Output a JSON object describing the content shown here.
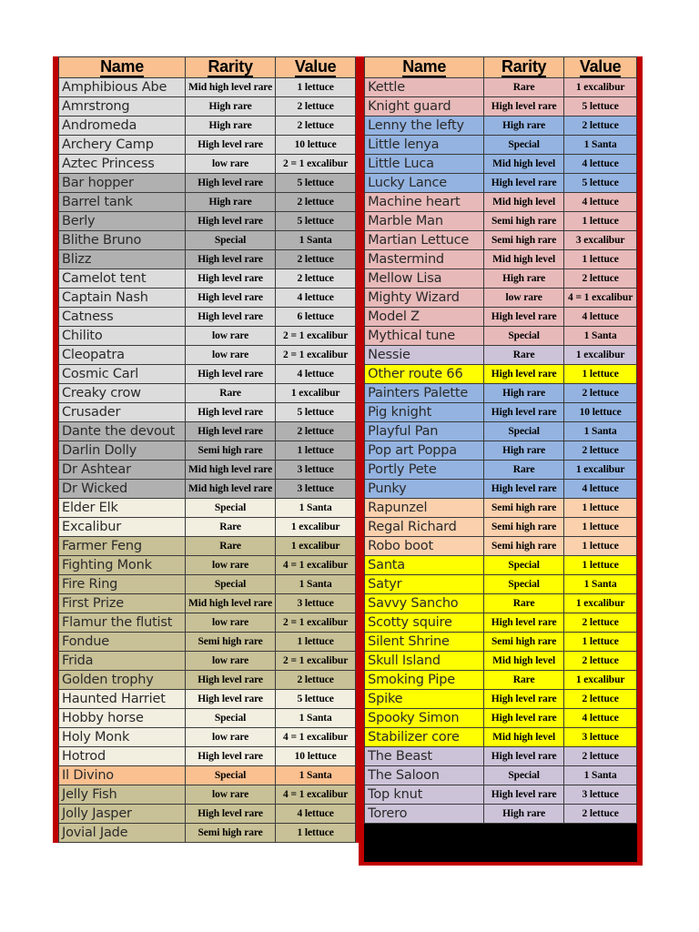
{
  "colors": {
    "frame_red": "#c00000",
    "header_bg": "#fac090",
    "group_light_gray": "#dcdcdc",
    "group_dark_gray": "#b0b0b0",
    "group_cream": "#f2efe1",
    "group_khaki": "#c8c096",
    "group_peach": "#fac090",
    "group_pink": "#e8b9b9",
    "group_blue": "#94b3e0",
    "group_lavender": "#cdc3d8",
    "group_yellow": "#ffff00",
    "group_black": "#000000"
  },
  "headers": {
    "name": "Name",
    "rarity": "Rarity",
    "value": "Value"
  },
  "left_table": {
    "rows": [
      {
        "name": "Amphibious Abe",
        "rarity": "Mid high level rare",
        "value": "1 lettuce",
        "bg": "#dcdcdc"
      },
      {
        "name": "Amrstrong",
        "rarity": "High rare",
        "value": "2 lettuce",
        "bg": "#dcdcdc"
      },
      {
        "name": "Andromeda",
        "rarity": "High rare",
        "value": "2 lettuce",
        "bg": "#dcdcdc"
      },
      {
        "name": "Archery Camp",
        "rarity": "High level rare",
        "value": "10 lettuce",
        "bg": "#dcdcdc"
      },
      {
        "name": "Aztec Princess",
        "rarity": "low rare",
        "value": "2 = 1 excalibur",
        "bg": "#dcdcdc"
      },
      {
        "name": "Bar hopper",
        "rarity": "High level rare",
        "value": "5 lettuce",
        "bg": "#b0b0b0"
      },
      {
        "name": "Barrel tank",
        "rarity": "High rare",
        "value": "2 lettuce",
        "bg": "#b0b0b0"
      },
      {
        "name": "Berly",
        "rarity": "High level rare",
        "value": "5 lettuce",
        "bg": "#b0b0b0"
      },
      {
        "name": "Blithe Bruno",
        "rarity": "Special",
        "value": "1 Santa",
        "bg": "#b0b0b0"
      },
      {
        "name": "Blizz",
        "rarity": "High level rare",
        "value": "2 lettuce",
        "bg": "#b0b0b0"
      },
      {
        "name": "Camelot tent",
        "rarity": "High level rare",
        "value": "2 lettuce",
        "bg": "#dcdcdc"
      },
      {
        "name": "Captain Nash",
        "rarity": "High level rare",
        "value": "4 lettuce",
        "bg": "#dcdcdc"
      },
      {
        "name": "Catness",
        "rarity": "High level rare",
        "value": "6 lettuce",
        "bg": "#dcdcdc"
      },
      {
        "name": "Chilito",
        "rarity": "low rare",
        "value": "2 = 1 excalibur",
        "bg": "#dcdcdc"
      },
      {
        "name": "Cleopatra",
        "rarity": "low rare",
        "value": "2 = 1 excalibur",
        "bg": "#dcdcdc"
      },
      {
        "name": "Cosmic Carl",
        "rarity": "High level rare",
        "value": "4 lettuce",
        "bg": "#dcdcdc"
      },
      {
        "name": "Creaky crow",
        "rarity": "Rare",
        "value": "1 excalibur",
        "bg": "#dcdcdc"
      },
      {
        "name": "Crusader",
        "rarity": "High level rare",
        "value": "5 lettuce",
        "bg": "#dcdcdc"
      },
      {
        "name": "Dante the devout",
        "rarity": "High level rare",
        "value": "2 lettuce",
        "bg": "#b0b0b0"
      },
      {
        "name": "Darlin Dolly",
        "rarity": "Semi high rare",
        "value": "1 lettuce",
        "bg": "#b0b0b0"
      },
      {
        "name": "Dr Ashtear",
        "rarity": "Mid high level rare",
        "value": "3 lettuce",
        "bg": "#b0b0b0"
      },
      {
        "name": "Dr Wicked",
        "rarity": "Mid high level rare",
        "value": "3 lettuce",
        "bg": "#b0b0b0"
      },
      {
        "name": "Elder Elk",
        "rarity": "Special",
        "value": "1 Santa",
        "bg": "#f2efe1"
      },
      {
        "name": "Excalibur",
        "rarity": "Rare",
        "value": "1 excalibur",
        "bg": "#f2efe1"
      },
      {
        "name": "Farmer Feng",
        "rarity": "Rare",
        "value": "1 excalibur",
        "bg": "#c8c096"
      },
      {
        "name": "Fighting Monk",
        "rarity": "low rare",
        "value": "4 = 1 excalibur",
        "bg": "#c8c096"
      },
      {
        "name": "Fire Ring",
        "rarity": "Special",
        "value": "1 Santa",
        "bg": "#c8c096"
      },
      {
        "name": "First Prize",
        "rarity": "Mid high level rare",
        "value": "3 lettuce",
        "bg": "#c8c096"
      },
      {
        "name": "Flamur the flutist",
        "rarity": "low rare",
        "value": "2 = 1 excalibur",
        "bg": "#c8c096"
      },
      {
        "name": "Fondue",
        "rarity": "Semi high rare",
        "value": "1 lettuce",
        "bg": "#c8c096"
      },
      {
        "name": "Frida",
        "rarity": "low rare",
        "value": "2 = 1 excalibur",
        "bg": "#c8c096"
      },
      {
        "name": "Golden trophy",
        "rarity": "High level rare",
        "value": "2 lettuce",
        "bg": "#c8c096"
      },
      {
        "name": "Haunted Harriet",
        "rarity": "High level rare",
        "value": "5 lettuce",
        "bg": "#f2efe1"
      },
      {
        "name": "Hobby horse",
        "rarity": "Special",
        "value": "1 Santa",
        "bg": "#f2efe1"
      },
      {
        "name": "Holy Monk",
        "rarity": "low rare",
        "value": "4 = 1 excalibur",
        "bg": "#f2efe1"
      },
      {
        "name": "Hotrod",
        "rarity": "High level rare",
        "value": "10 lettuce",
        "bg": "#f2efe1"
      },
      {
        "name": "Il Divino",
        "rarity": "Special",
        "value": "1 Santa",
        "bg": "#fac090"
      },
      {
        "name": "Jelly Fish",
        "rarity": "low rare",
        "value": "4 = 1 excalibur",
        "bg": "#c8c096"
      },
      {
        "name": "Jolly Jasper",
        "rarity": "High level rare",
        "value": "4 lettuce",
        "bg": "#c8c096"
      },
      {
        "name": "Jovial Jade",
        "rarity": "Semi high rare",
        "value": "1 lettuce",
        "bg": "#c8c096"
      }
    ]
  },
  "right_table": {
    "rows": [
      {
        "name": "Kettle",
        "rarity": "Rare",
        "value": "1 excalibur",
        "bg": "#e8b9b9"
      },
      {
        "name": "Knight guard",
        "rarity": "High level rare",
        "value": "5 lettuce",
        "bg": "#e8b9b9"
      },
      {
        "name": "Lenny the lefty",
        "rarity": "High rare",
        "value": "2 lettuce",
        "bg": "#94b3e0"
      },
      {
        "name": "Little lenya",
        "rarity": "Special",
        "value": "1 Santa",
        "bg": "#94b3e0"
      },
      {
        "name": "Little Luca",
        "rarity": "Mid high level",
        "value": "4 lettuce",
        "bg": "#94b3e0"
      },
      {
        "name": "Lucky Lance",
        "rarity": "High level rare",
        "value": "5 lettuce",
        "bg": "#94b3e0"
      },
      {
        "name": "Machine heart",
        "rarity": "Mid high level",
        "value": "4 lettuce",
        "bg": "#e8b9b9"
      },
      {
        "name": "Marble Man",
        "rarity": "Semi high rare",
        "value": "1 lettuce",
        "bg": "#e8b9b9"
      },
      {
        "name": "Martian Lettuce",
        "rarity": "Semi high rare",
        "value": "3 excalibur",
        "bg": "#e8b9b9"
      },
      {
        "name": "Mastermind",
        "rarity": "Mid high level",
        "value": "1 lettuce",
        "bg": "#e8b9b9"
      },
      {
        "name": "Mellow Lisa",
        "rarity": "High rare",
        "value": "2 lettuce",
        "bg": "#e8b9b9"
      },
      {
        "name": "Mighty Wizard",
        "rarity": "low rare",
        "value": "4 = 1 excalibur",
        "bg": "#e8b9b9"
      },
      {
        "name": "Model Z",
        "rarity": "High level rare",
        "value": "4 lettuce",
        "bg": "#e8b9b9"
      },
      {
        "name": "Mythical tune",
        "rarity": "Special",
        "value": "1 Santa",
        "bg": "#e8b9b9"
      },
      {
        "name": "Nessie",
        "rarity": "Rare",
        "value": "1 excalibur",
        "bg": "#cdc3d8"
      },
      {
        "name": "Other route 66",
        "rarity": "High level rare",
        "value": "1 lettuce",
        "bg": "#ffff00"
      },
      {
        "name": "Painters Palette",
        "rarity": "High rare",
        "value": "2 lettuce",
        "bg": "#94b3e0"
      },
      {
        "name": "Pig knight",
        "rarity": "High level rare",
        "value": "10 lettuce",
        "bg": "#94b3e0"
      },
      {
        "name": "Playful Pan",
        "rarity": "Special",
        "value": "1 Santa",
        "bg": "#94b3e0"
      },
      {
        "name": "Pop art Poppa",
        "rarity": "High rare",
        "value": "2 lettuce",
        "bg": "#94b3e0"
      },
      {
        "name": "Portly Pete",
        "rarity": "Rare",
        "value": "1 excalibur",
        "bg": "#94b3e0"
      },
      {
        "name": "Punky",
        "rarity": "High level rare",
        "value": "4 lettuce",
        "bg": "#94b3e0"
      },
      {
        "name": "Rapunzel",
        "rarity": "Semi high rare",
        "value": "1 lettuce",
        "bg": "#fad0ad"
      },
      {
        "name": "Regal Richard",
        "rarity": "Semi high rare",
        "value": "1 lettuce",
        "bg": "#fad0ad"
      },
      {
        "name": "Robo boot",
        "rarity": "Semi high rare",
        "value": "1 lettuce",
        "bg": "#fad0ad"
      },
      {
        "name": "Santa",
        "rarity": "Special",
        "value": "1 lettuce",
        "bg": "#ffff00"
      },
      {
        "name": "Satyr",
        "rarity": "Special",
        "value": "1 Santa",
        "bg": "#ffff00"
      },
      {
        "name": "Savvy Sancho",
        "rarity": "Rare",
        "value": "1 excalibur",
        "bg": "#ffff00"
      },
      {
        "name": "Scotty squire",
        "rarity": "High level rare",
        "value": "2 lettuce",
        "bg": "#ffff00"
      },
      {
        "name": "Silent Shrine",
        "rarity": "Semi high rare",
        "value": "1 lettuce",
        "bg": "#ffff00"
      },
      {
        "name": "Skull Island",
        "rarity": "Mid high level",
        "value": "2 lettuce",
        "bg": "#ffff00"
      },
      {
        "name": "Smoking Pipe",
        "rarity": "Rare",
        "value": "1 excalibur",
        "bg": "#ffff00"
      },
      {
        "name": "Spike",
        "rarity": "High level rare",
        "value": "2 lettuce",
        "bg": "#ffff00"
      },
      {
        "name": "Spooky Simon",
        "rarity": "High level rare",
        "value": "4 lettuce",
        "bg": "#ffff00"
      },
      {
        "name": "Stabilizer core",
        "rarity": "Mid high level",
        "value": "3 lettuce",
        "bg": "#ffff00"
      },
      {
        "name": "The Beast",
        "rarity": "High level rare",
        "value": "2 lettuce",
        "bg": "#cdc3d8"
      },
      {
        "name": "The Saloon",
        "rarity": "Special",
        "value": "1 Santa",
        "bg": "#cdc3d8"
      },
      {
        "name": "Top knut",
        "rarity": "High level rare",
        "value": "3 lettuce",
        "bg": "#cdc3d8"
      },
      {
        "name": "Torero",
        "rarity": "High rare",
        "value": "2 lettuce",
        "bg": "#cdc3d8"
      },
      {
        "name": "",
        "rarity": "",
        "value": "",
        "bg": "#000000"
      },
      {
        "name": "",
        "rarity": "",
        "value": "",
        "bg": "#000000"
      }
    ]
  }
}
